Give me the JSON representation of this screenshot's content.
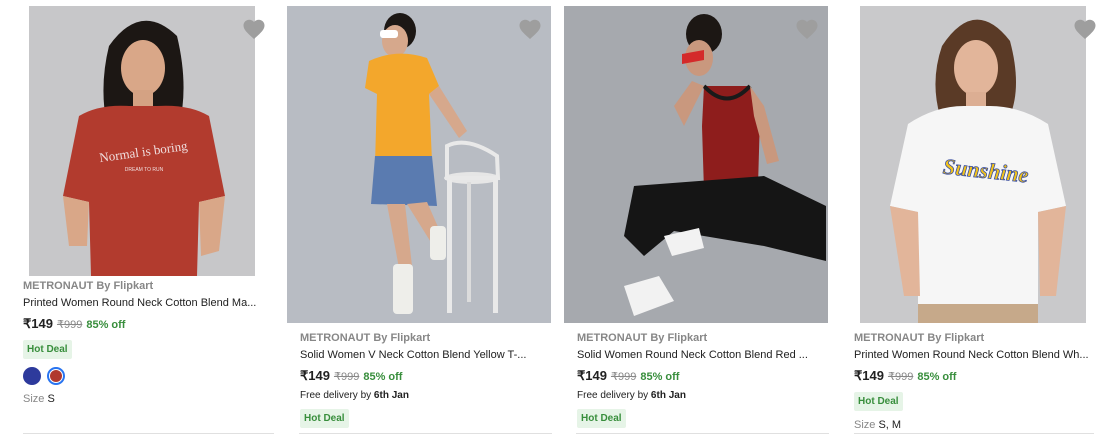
{
  "products": [
    {
      "brand": "METRONAUT By Flipkart",
      "title": "Printed Women Round Neck Cotton Blend Ma...",
      "price": "₹149",
      "mrp": "₹999",
      "discount": "85% off",
      "badge": "Hot Deal",
      "swatch_colors": [
        "#2d3a9c",
        "#b0382e"
      ],
      "size_label": "Size",
      "size_value": "S",
      "shirt_print_line1": "Normal is boring",
      "shirt_print_line2": "DREAM TO RUN",
      "image_bg": "#c7c7c9",
      "shirt_color": "#b23b2e"
    },
    {
      "brand": "METRONAUT By Flipkart",
      "title": "Solid Women V Neck Cotton Blend Yellow T-...",
      "price": "₹149",
      "mrp": "₹999",
      "discount": "85% off",
      "delivery_prefix": "Free delivery by",
      "delivery_date": "6th Jan",
      "badge": "Hot Deal",
      "image_bg": "#b8bcc3",
      "shirt_color": "#f3a72c"
    },
    {
      "brand": "METRONAUT By Flipkart",
      "title": "Solid Women Round Neck Cotton Blend Red ...",
      "price": "₹149",
      "mrp": "₹999",
      "discount": "85% off",
      "delivery_prefix": "Free delivery by",
      "delivery_date": "6th Jan",
      "badge": "Hot Deal",
      "image_bg": "#a6a9ae",
      "shirt_color": "#8e1d1c"
    },
    {
      "brand": "METRONAUT By Flipkart",
      "title": "Printed Women Round Neck Cotton Blend Wh...",
      "price": "₹149",
      "mrp": "₹999",
      "discount": "85% off",
      "badge": "Hot Deal",
      "size_label": "Size",
      "size_value": "S, M",
      "shirt_print_line1": "Sunshine",
      "image_bg": "#c9c9cb",
      "shirt_color": "#f6f6f6"
    }
  ],
  "colors": {
    "heart": "#9e9e9e",
    "discount_green": "#388e3c",
    "badge_bg": "#e6f4e7"
  }
}
